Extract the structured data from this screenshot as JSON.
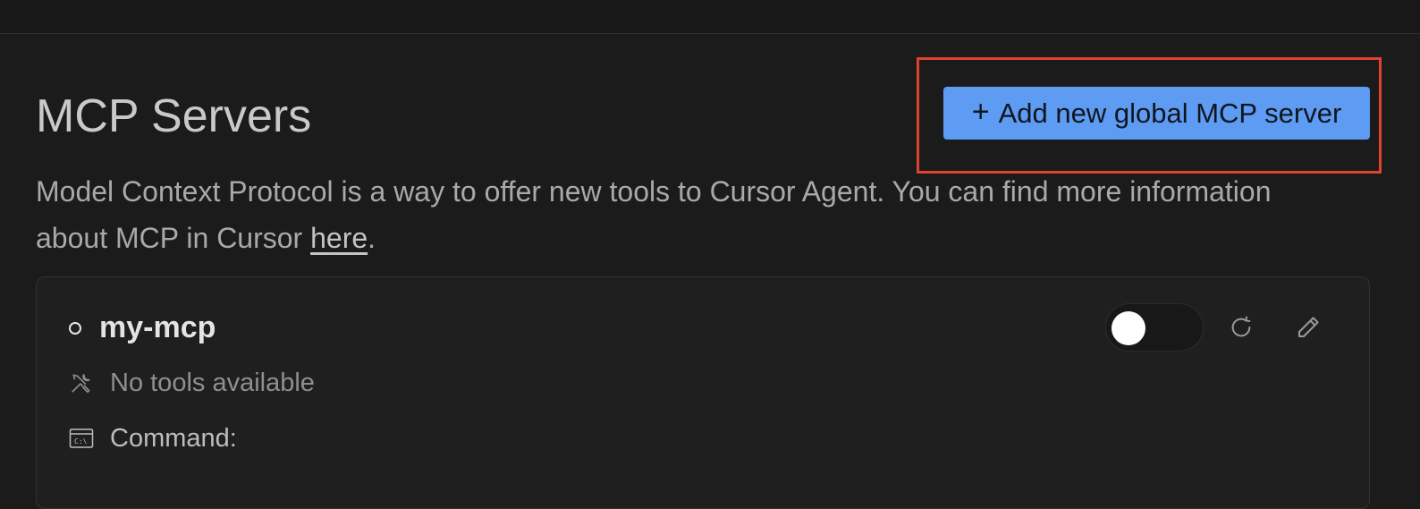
{
  "page": {
    "title": "MCP Servers",
    "description_text": "Model Context Protocol is a way to offer new tools to Cursor Agent. You can find more information about MCP in Cursor ",
    "description_link": "here",
    "description_end": "."
  },
  "actions": {
    "add_button_icon": "plus-icon",
    "add_button_label": "Add new global MCP server"
  },
  "server": {
    "name": "my-mcp",
    "status_icon": "status-dot-icon",
    "enabled": false,
    "tools_icon": "tools-icon",
    "tools_label": "No tools available",
    "command_icon": "terminal-icon",
    "command_label": "Command:"
  },
  "colors": {
    "accent": "#5e9bf2",
    "highlight": "#e0432f",
    "background": "#1b1b1b"
  }
}
